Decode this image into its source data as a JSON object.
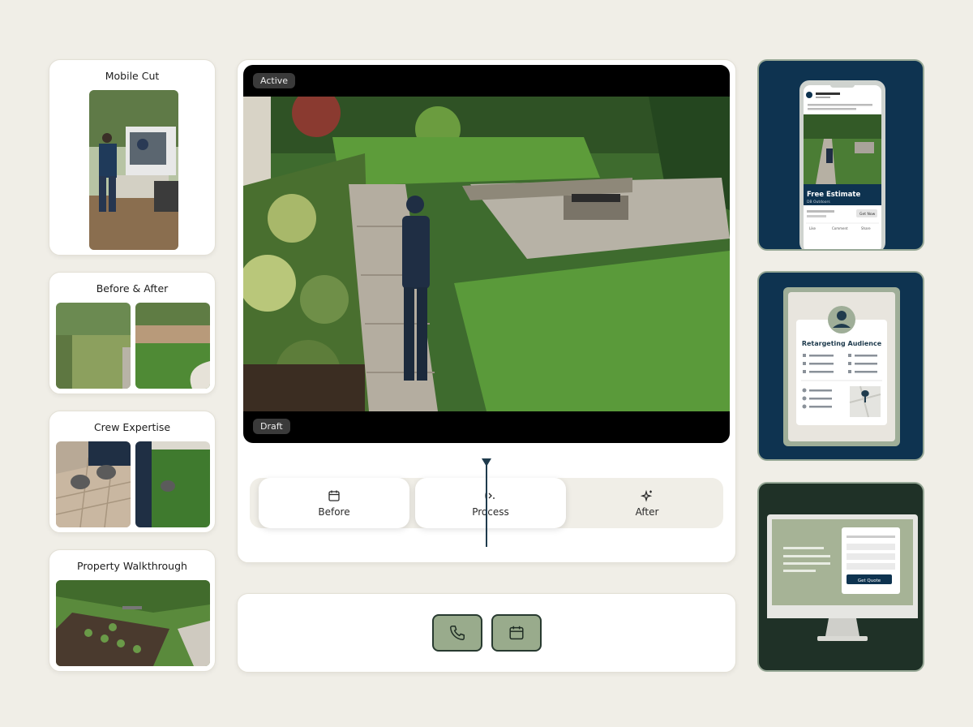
{
  "clips": [
    {
      "title": "Mobile Cut",
      "icon": "skid-steer-photo"
    },
    {
      "title": "Before & After",
      "icon": "before-after-photos"
    },
    {
      "title": "Crew Expertise",
      "icon": "crew-photos"
    },
    {
      "title": "Property Walkthrough",
      "icon": "drone-photo"
    }
  ],
  "viewer": {
    "top_chip": "Active",
    "bottom_chip": "Draft"
  },
  "timeline": {
    "segments": [
      {
        "label": "Before",
        "icon": "calendar-icon"
      },
      {
        "label": "Process",
        "icon": "process-icon"
      },
      {
        "label": "After",
        "icon": "sparkle-icon"
      }
    ]
  },
  "actions": {
    "call_icon": "phone-icon",
    "schedule_icon": "calendar-icon"
  },
  "previews": {
    "social": {
      "headline": "Free Estimate",
      "subline": "DB Outdoors",
      "cta": "Get Now",
      "actions": [
        "Like",
        "Comment",
        "Share"
      ]
    },
    "retargeting": {
      "title": "Retargeting Audience"
    },
    "landing": {
      "cta": "Get Quote"
    }
  },
  "colors": {
    "accent_green": "#99ab8c",
    "navy": "#0e3350",
    "dark_green": "#1f3127",
    "background": "#f0eee7"
  }
}
